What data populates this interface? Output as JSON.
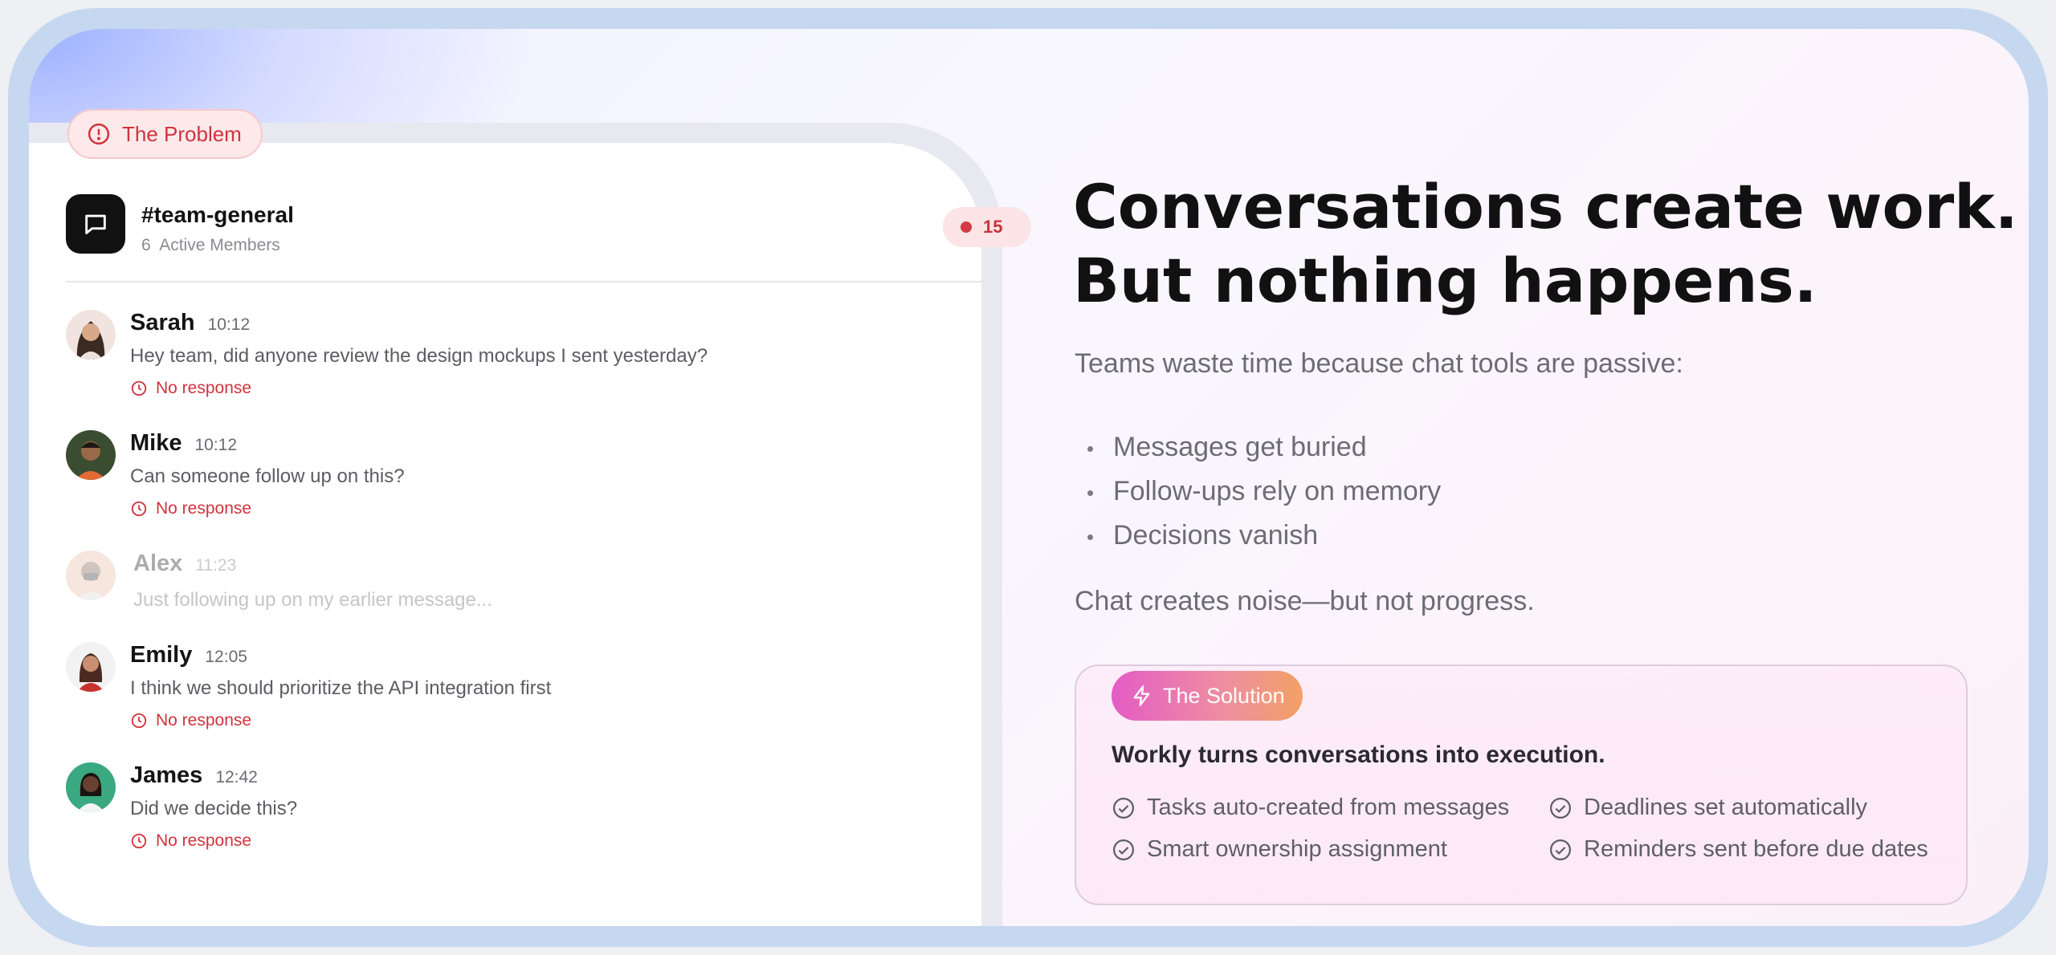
{
  "problem_badge": {
    "label": "The Problem",
    "icon": "alert-circle-icon",
    "color": "#d1333d"
  },
  "channel": {
    "name": "#team-general",
    "members_count": "6",
    "members_label": "Active Members",
    "unread_count": "15"
  },
  "messages": [
    {
      "name": "Sarah",
      "time": "10:12",
      "text": "Hey team, did anyone review the design mockups I sent yesterday?",
      "status": "No response"
    },
    {
      "name": "Mike",
      "time": "10:12",
      "text": "Can someone follow up on this?",
      "status": "No response"
    },
    {
      "name": "Alex",
      "time": "11:23",
      "text": "Just following up on my earlier message..."
    },
    {
      "name": "Emily",
      "time": "12:05",
      "text": "I think we should prioritize the API integration first",
      "status": "No response"
    },
    {
      "name": "James",
      "time": "12:42",
      "text": "Did we decide this?",
      "status": "No response"
    }
  ],
  "headline": {
    "line1": "Conversations create work.",
    "line2": "But nothing happens."
  },
  "lead": "Teams waste time because chat tools are passive:",
  "bullets": [
    "Messages get buried",
    "Follow-ups rely on memory",
    "Decisions vanish"
  ],
  "closing": "Chat creates noise—but not progress.",
  "solution": {
    "badge": "The Solution",
    "icon": "lightning-icon",
    "title": "Workly turns conversations into execution.",
    "features": [
      "Tasks auto-created from messages",
      "Deadlines set automatically",
      "Smart ownership assignment",
      "Reminders sent before due dates"
    ]
  },
  "colors": {
    "accent_red": "#d1333d",
    "frame": "#c6d7f0",
    "headline": "#111111"
  }
}
